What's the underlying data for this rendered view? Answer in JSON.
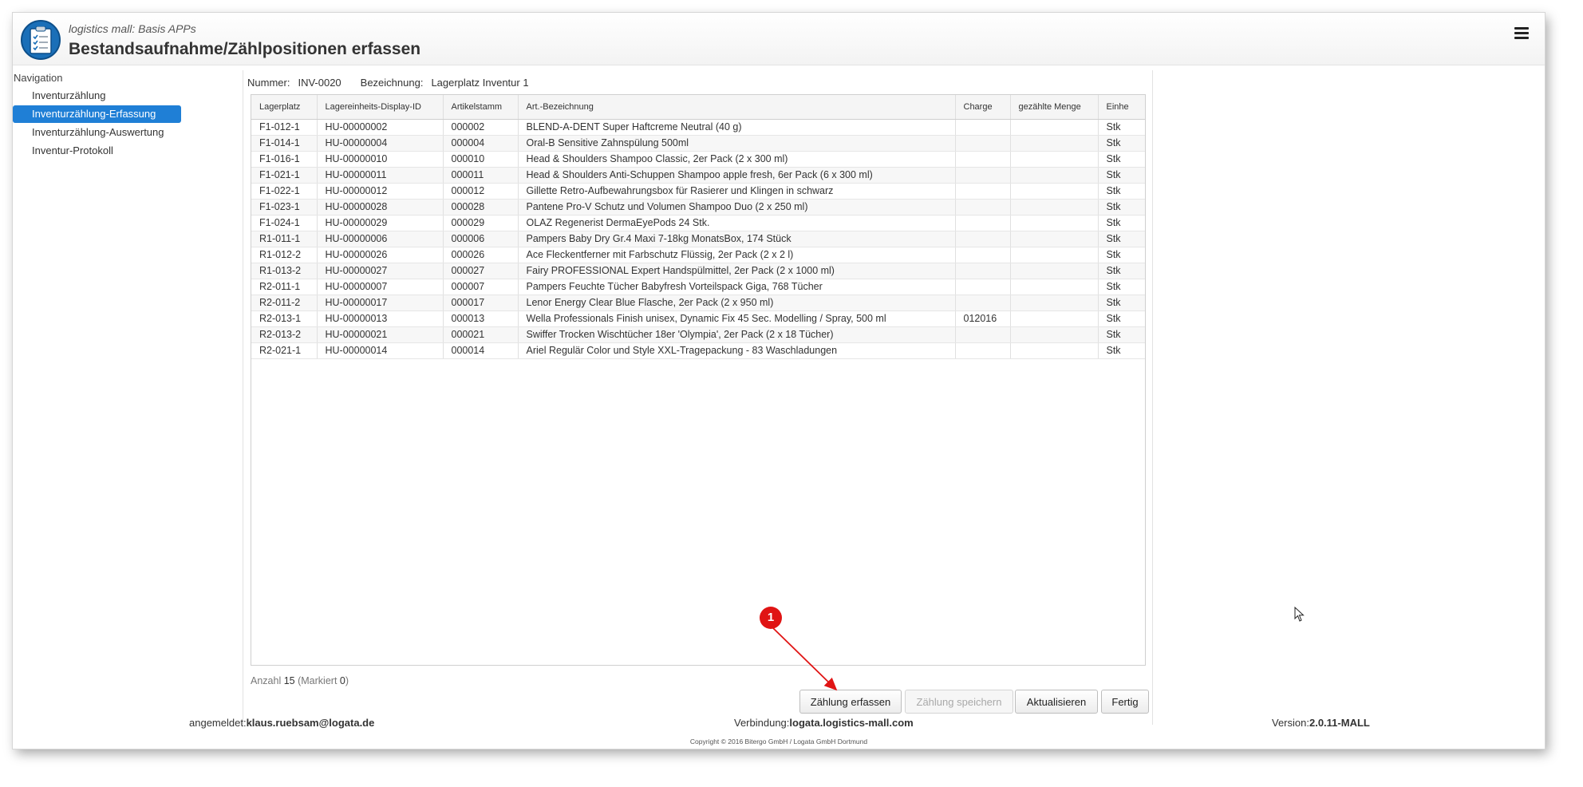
{
  "header": {
    "subtitle": "logistics mall: Basis APPs",
    "title": "Bestandsaufnahme/Zählpositionen erfassen"
  },
  "nav": {
    "heading": "Navigation",
    "items": [
      {
        "label": "Inventurzählung"
      },
      {
        "label": "Inventurzählung-Erfassung"
      },
      {
        "label": "Inventurzählung-Auswertung"
      },
      {
        "label": "Inventur-Protokoll"
      }
    ]
  },
  "info": {
    "nummer_label": "Nummer:",
    "nummer_value": "INV-0020",
    "bezeichnung_label": "Bezeichnung:",
    "bezeichnung_value": "Lagerplatz Inventur 1"
  },
  "table": {
    "columns": [
      "Lagerplatz",
      "Lagereinheits-Display-ID",
      "Artikelstamm",
      "Art.-Bezeichnung",
      "Charge",
      "gezählte Menge",
      "Einhe"
    ],
    "rows": [
      [
        "F1-012-1",
        "HU-00000002",
        "000002",
        "BLEND-A-DENT Super Haftcreme Neutral (40 g)",
        "",
        "",
        "Stk"
      ],
      [
        "F1-014-1",
        "HU-00000004",
        "000004",
        "Oral-B Sensitive Zahnspülung 500ml",
        "",
        "",
        "Stk"
      ],
      [
        "F1-016-1",
        "HU-00000010",
        "000010",
        "Head & Shoulders Shampoo Classic, 2er Pack (2 x 300 ml)",
        "",
        "",
        "Stk"
      ],
      [
        "F1-021-1",
        "HU-00000011",
        "000011",
        "Head & Shoulders Anti-Schuppen Shampoo apple fresh, 6er Pack (6 x 300 ml)",
        "",
        "",
        "Stk"
      ],
      [
        "F1-022-1",
        "HU-00000012",
        "000012",
        "Gillette Retro-Aufbewahrungsbox für Rasierer und Klingen in schwarz",
        "",
        "",
        "Stk"
      ],
      [
        "F1-023-1",
        "HU-00000028",
        "000028",
        "Pantene Pro-V Schutz und Volumen Shampoo Duo (2 x 250 ml)",
        "",
        "",
        "Stk"
      ],
      [
        "F1-024-1",
        "HU-00000029",
        "000029",
        "OLAZ Regenerist DermaEyePods 24 Stk.",
        "",
        "",
        "Stk"
      ],
      [
        "R1-011-1",
        "HU-00000006",
        "000006",
        "Pampers Baby Dry Gr.4 Maxi 7-18kg MonatsBox, 174 Stück",
        "",
        "",
        "Stk"
      ],
      [
        "R1-012-2",
        "HU-00000026",
        "000026",
        "Ace Fleckentferner mit Farbschutz Flüssig, 2er Pack (2 x 2 l)",
        "",
        "",
        "Stk"
      ],
      [
        "R1-013-2",
        "HU-00000027",
        "000027",
        "Fairy PROFESSIONAL Expert Handspülmittel, 2er Pack (2 x 1000 ml)",
        "",
        "",
        "Stk"
      ],
      [
        "R2-011-1",
        "HU-00000007",
        "000007",
        "Pampers Feuchte Tücher Babyfresh Vorteilspack Giga, 768 Tücher",
        "",
        "",
        "Stk"
      ],
      [
        "R2-011-2",
        "HU-00000017",
        "000017",
        "Lenor Energy Clear Blue Flasche, 2er Pack (2 x 950 ml)",
        "",
        "",
        "Stk"
      ],
      [
        "R2-013-1",
        "HU-00000013",
        "000013",
        "Wella Professionals Finish unisex, Dynamic Fix 45 Sec. Modelling / Spray, 500 ml",
        "012016",
        "",
        "Stk"
      ],
      [
        "R2-013-2",
        "HU-00000021",
        "000021",
        "Swiffer Trocken Wischtücher 18er 'Olympia', 2er Pack (2 x 18 Tücher)",
        "",
        "",
        "Stk"
      ],
      [
        "R2-021-1",
        "HU-00000014",
        "000014",
        "Ariel Regulär Color und Style XXL-Tragepackung - 83 Waschladungen",
        "",
        "",
        "Stk"
      ]
    ]
  },
  "count": {
    "anzahl_label": "Anzahl",
    "anzahl_value": "15",
    "markiert_label": "(Markiert",
    "markiert_value": "0",
    "close": ")"
  },
  "buttons": {
    "zaehlung_erfassen": "Zählung erfassen",
    "zaehlung_speichern": "Zählung speichern",
    "aktualisieren": "Aktualisieren",
    "fertig": "Fertig"
  },
  "footer": {
    "user_label": "angemeldet:",
    "user_value": "klaus.ruebsam@logata.de",
    "connection_label": "Verbindung:",
    "connection_value": "logata.logistics-mall.com",
    "version_label": "Version:",
    "version_value": "2.0.11-MALL",
    "copyright": "Copyright © 2016 Bitergo GmbH / Logata GmbH Dortmund"
  },
  "annotation": {
    "number": "1",
    "color": "#e01414"
  },
  "colors": {
    "accent": "#1f7fd6",
    "logo": "#1a6fb8"
  },
  "icons": [
    "checklist-icon",
    "hamburger-menu-icon",
    "mouse-cursor-icon"
  ]
}
